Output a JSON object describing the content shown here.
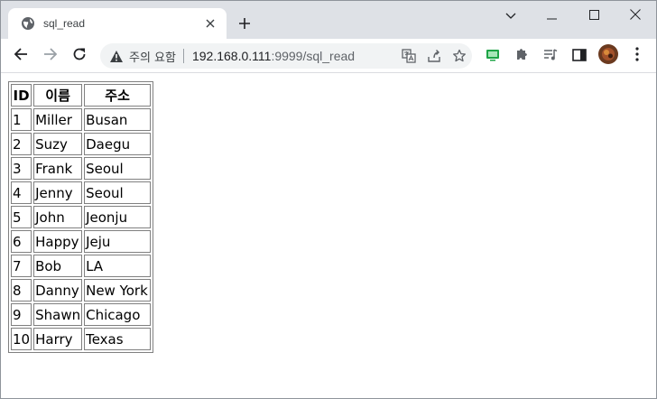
{
  "browser": {
    "tab": {
      "title": "sql_read",
      "favicon": "globe-icon"
    },
    "new_tab_icon": "plus-icon",
    "window_controls": [
      "chevron-down-icon",
      "minimize-icon",
      "maximize-icon",
      "close-icon"
    ],
    "omnibox": {
      "security_label": "주의 요함",
      "url_host": "192.168.0.111",
      "url_rest": ":9999/sql_read"
    },
    "avatar_color": "#6b3a1f"
  },
  "table": {
    "headers": [
      "ID",
      "이름",
      "주소"
    ],
    "rows": [
      {
        "id": "1",
        "name": "Miller",
        "address": "Busan"
      },
      {
        "id": "2",
        "name": "Suzy",
        "address": "Daegu"
      },
      {
        "id": "3",
        "name": "Frank",
        "address": "Seoul"
      },
      {
        "id": "4",
        "name": "Jenny",
        "address": "Seoul"
      },
      {
        "id": "5",
        "name": "John",
        "address": "Jeonju"
      },
      {
        "id": "6",
        "name": "Happy",
        "address": "Jeju"
      },
      {
        "id": "7",
        "name": "Bob",
        "address": "LA"
      },
      {
        "id": "8",
        "name": "Danny",
        "address": "New York"
      },
      {
        "id": "9",
        "name": "Shawn",
        "address": "Chicago"
      },
      {
        "id": "10",
        "name": "Harry",
        "address": "Texas"
      }
    ]
  }
}
